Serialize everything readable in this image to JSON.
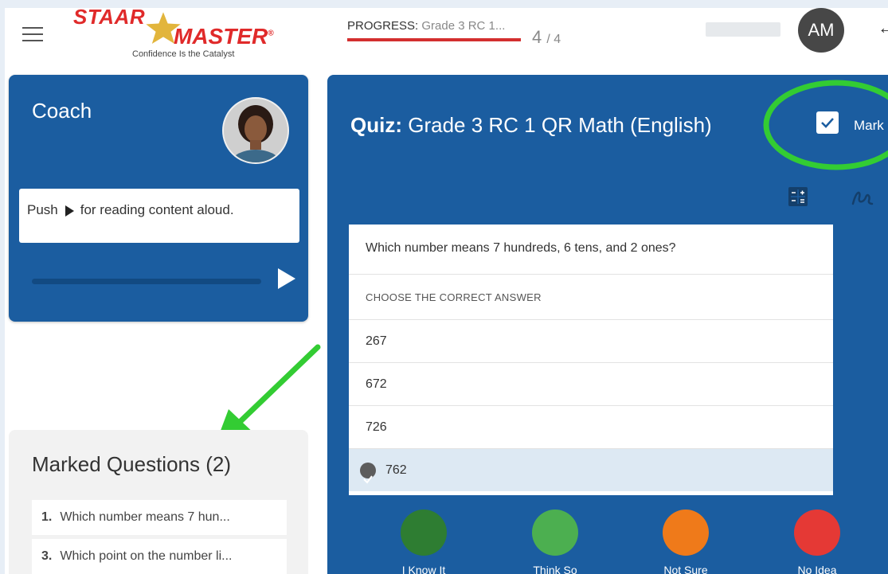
{
  "header": {
    "logo": {
      "word1": "STAAR",
      "word2": "MASTER",
      "trademark": "®",
      "tagline": "Confidence Is the Catalyst"
    },
    "progress": {
      "label": "PROGRESS:",
      "course": "Grade 3 RC 1...",
      "current": "4",
      "separator": "/",
      "total": "4",
      "fill_fraction": 1.0
    },
    "user_initials": "AM"
  },
  "coach": {
    "title": "Coach",
    "message_before": "Push",
    "message_after": "for reading content aloud."
  },
  "marked_questions": {
    "title": "Marked Questions (2)",
    "items": [
      {
        "num": "1.",
        "text": "Which number means 7 hun..."
      },
      {
        "num": "3.",
        "text": "Which point on the number li..."
      }
    ]
  },
  "quiz": {
    "label": "Quiz:",
    "title": "Grade 3 RC 1 QR Math (English)",
    "mark_label": "Mark",
    "mark_checked": true,
    "question": "Which number means 7 hundreds, 6 tens, and 2 ones?",
    "instruction": "CHOOSE THE CORRECT ANSWER",
    "options": [
      "267",
      "672",
      "726",
      "762"
    ],
    "selected_option": "762",
    "confidence": [
      {
        "label": "I Know It",
        "color": "#2e7d32"
      },
      {
        "label": "Think So",
        "color": "#4caf50"
      },
      {
        "label": "Not Sure",
        "color": "#ef7a1a"
      },
      {
        "label": "No Idea",
        "color": "#e53935"
      }
    ]
  },
  "colors": {
    "primary_blue": "#1b5da0",
    "progress_red": "#d32f2f",
    "annotation_green": "#33cc33"
  },
  "icons": [
    "menu-icon",
    "staar-star-icon",
    "back-arrow-icon",
    "play-icon",
    "calculator-icon",
    "draw-icon",
    "check-icon"
  ]
}
